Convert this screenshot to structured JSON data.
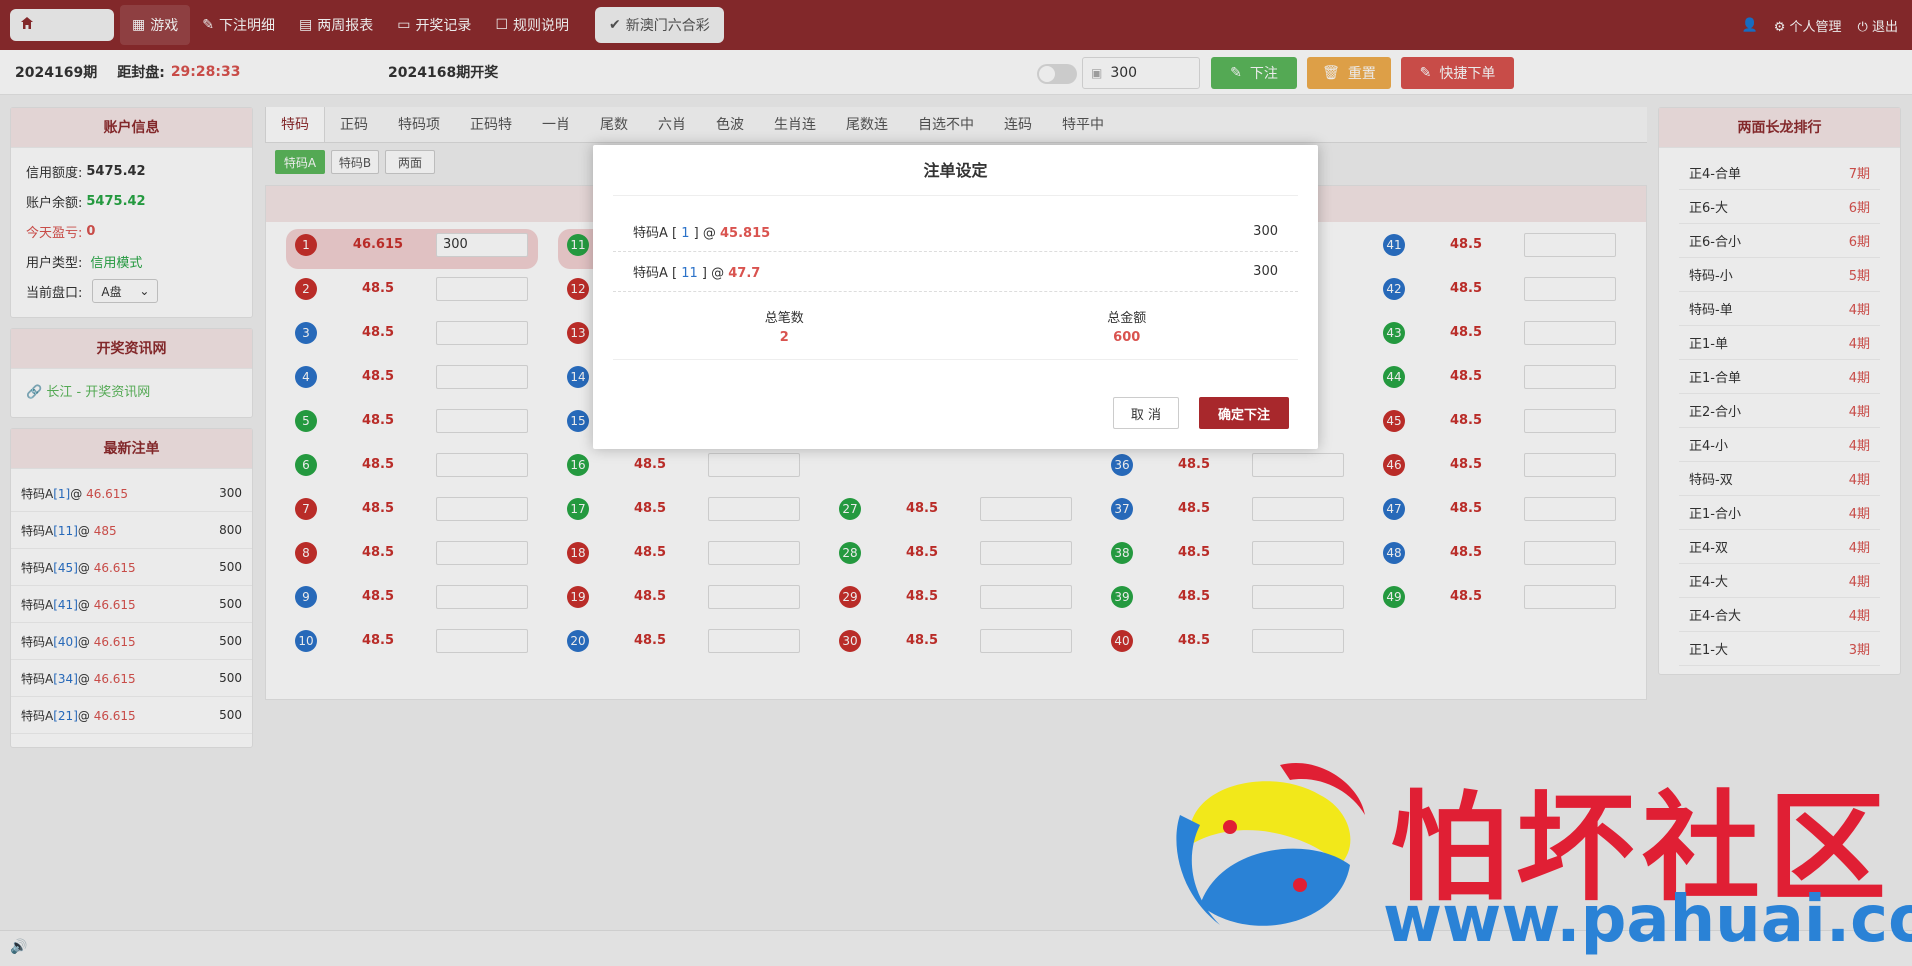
{
  "topbar": {
    "home_icon": "home-icon",
    "nav": [
      {
        "label": "游戏",
        "icon": "grid-icon"
      },
      {
        "label": "下注明细",
        "icon": "pen-icon"
      },
      {
        "label": "两周报表",
        "icon": "calendar-icon"
      },
      {
        "label": "开奖记录",
        "icon": "monitor-icon"
      },
      {
        "label": "规则说明",
        "icon": "doc-icon"
      }
    ],
    "game": "新澳门六合彩",
    "user_manage": "个人管理",
    "logout": "退出"
  },
  "subbar": {
    "period": "2024169期",
    "close_label": "距封盘:",
    "close_time": "29:28:33",
    "last_draw": "2024168期开奖",
    "amount": "300",
    "bet_btn": "下注",
    "reset_btn": "重置",
    "quick_btn": "快捷下单",
    "colors": {
      "green": "#5cb85c",
      "orange": "#f0ad4e",
      "red": "#d9534f"
    }
  },
  "account": {
    "title": "账户信息",
    "credit_label": "信用额度:",
    "credit": "5475.42",
    "balance_label": "账户余额:",
    "balance": "5475.42",
    "pnl_label": "今天盈亏:",
    "pnl": "0",
    "type_label": "用户类型:",
    "type": "信用模式",
    "market_label": "当前盘口:",
    "market": "A盘"
  },
  "info": {
    "title": "开奖资讯网",
    "link": "长江 - 开奖资讯网"
  },
  "recent": {
    "title": "最新注单",
    "items": [
      {
        "name": "特码A",
        "num": "1",
        "odds": "46.615",
        "amount": "300"
      },
      {
        "name": "特码A",
        "num": "11",
        "odds": "485",
        "amount": "800"
      },
      {
        "name": "特码A",
        "num": "45",
        "odds": "46.615",
        "amount": "500"
      },
      {
        "name": "特码A",
        "num": "41",
        "odds": "46.615",
        "amount": "500"
      },
      {
        "name": "特码A",
        "num": "40",
        "odds": "46.615",
        "amount": "500"
      },
      {
        "name": "特码A",
        "num": "34",
        "odds": "46.615",
        "amount": "500"
      },
      {
        "name": "特码A",
        "num": "21",
        "odds": "46.615",
        "amount": "500"
      }
    ]
  },
  "tabs": [
    "特码",
    "正码",
    "特码项",
    "正码特",
    "一肖",
    "尾数",
    "六肖",
    "色波",
    "生肖连",
    "尾数连",
    "自选不中",
    "连码",
    "特平中"
  ],
  "subtabs": [
    "特码A",
    "特码B",
    "两面"
  ],
  "balls": {
    "c1": [
      {
        "n": "1",
        "c": "r",
        "odds": "46.615",
        "val": "300"
      },
      {
        "n": "2",
        "c": "r",
        "odds": "48.5",
        "val": ""
      },
      {
        "n": "3",
        "c": "b",
        "odds": "48.5",
        "val": ""
      },
      {
        "n": "4",
        "c": "b",
        "odds": "48.5",
        "val": ""
      },
      {
        "n": "5",
        "c": "g",
        "odds": "48.5",
        "val": ""
      },
      {
        "n": "6",
        "c": "g",
        "odds": "48.5",
        "val": ""
      },
      {
        "n": "7",
        "c": "r",
        "odds": "48.5",
        "val": ""
      },
      {
        "n": "8",
        "c": "r",
        "odds": "48.5",
        "val": ""
      },
      {
        "n": "9",
        "c": "b",
        "odds": "48.5",
        "val": ""
      },
      {
        "n": "10",
        "c": "b",
        "odds": "48.5",
        "val": ""
      }
    ],
    "c2": [
      {
        "n": "11",
        "c": "g",
        "odds": "",
        "val": ""
      },
      {
        "n": "12",
        "c": "r",
        "odds": "",
        "val": ""
      },
      {
        "n": "13",
        "c": "r",
        "odds": "",
        "val": ""
      },
      {
        "n": "14",
        "c": "b",
        "odds": "",
        "val": ""
      },
      {
        "n": "15",
        "c": "b",
        "odds": "",
        "val": ""
      },
      {
        "n": "16",
        "c": "g",
        "odds": "48.5",
        "val": ""
      },
      {
        "n": "17",
        "c": "g",
        "odds": "48.5",
        "val": ""
      },
      {
        "n": "18",
        "c": "r",
        "odds": "48.5",
        "val": ""
      },
      {
        "n": "19",
        "c": "r",
        "odds": "48.5",
        "val": ""
      },
      {
        "n": "20",
        "c": "b",
        "odds": "48.5",
        "val": ""
      }
    ],
    "c3": [
      {
        "n": "27",
        "c": "g",
        "odds": "48.5",
        "val": ""
      },
      {
        "n": "28",
        "c": "g",
        "odds": "48.5",
        "val": ""
      },
      {
        "n": "29",
        "c": "r",
        "odds": "48.5",
        "val": ""
      },
      {
        "n": "30",
        "c": "r",
        "odds": "48.5",
        "val": ""
      }
    ],
    "c4": [
      {
        "n": "36",
        "c": "b",
        "odds": "48.5",
        "val": ""
      },
      {
        "n": "37",
        "c": "b",
        "odds": "48.5",
        "val": ""
      },
      {
        "n": "38",
        "c": "g",
        "odds": "48.5",
        "val": ""
      },
      {
        "n": "39",
        "c": "g",
        "odds": "48.5",
        "val": ""
      },
      {
        "n": "40",
        "c": "r",
        "odds": "48.5",
        "val": ""
      }
    ],
    "c5": [
      {
        "n": "41",
        "c": "b",
        "odds": "48.5",
        "val": ""
      },
      {
        "n": "42",
        "c": "b",
        "odds": "48.5",
        "val": ""
      },
      {
        "n": "43",
        "c": "g",
        "odds": "48.5",
        "val": ""
      },
      {
        "n": "44",
        "c": "g",
        "odds": "48.5",
        "val": ""
      },
      {
        "n": "45",
        "c": "r",
        "odds": "48.5",
        "val": ""
      },
      {
        "n": "46",
        "c": "r",
        "odds": "48.5",
        "val": ""
      },
      {
        "n": "47",
        "c": "b",
        "odds": "48.5",
        "val": ""
      },
      {
        "n": "48",
        "c": "b",
        "odds": "48.5",
        "val": ""
      },
      {
        "n": "49",
        "c": "g",
        "odds": "48.5",
        "val": ""
      }
    ]
  },
  "modal": {
    "title": "注单设定",
    "rows": [
      {
        "name": "特码A",
        "num": "1",
        "odds": "45.815",
        "amount": "300"
      },
      {
        "name": "特码A",
        "num": "11",
        "odds": "47.7",
        "amount": "300"
      }
    ],
    "count_label": "总笔数",
    "count": "2",
    "total_label": "总金额",
    "total": "600",
    "cancel": "取 消",
    "confirm": "确定下注"
  },
  "rank": {
    "title": "两面长龙排行",
    "items": [
      {
        "name": "正4-合单",
        "period": "7期"
      },
      {
        "name": "正6-大",
        "period": "6期"
      },
      {
        "name": "正6-合小",
        "period": "6期"
      },
      {
        "name": "特码-小",
        "period": "5期"
      },
      {
        "name": "特码-单",
        "period": "4期"
      },
      {
        "name": "正1-单",
        "period": "4期"
      },
      {
        "name": "正1-合单",
        "period": "4期"
      },
      {
        "name": "正2-合小",
        "period": "4期"
      },
      {
        "name": "正4-小",
        "period": "4期"
      },
      {
        "name": "特码-双",
        "period": "4期"
      },
      {
        "name": "正1-合小",
        "period": "4期"
      },
      {
        "name": "正4-双",
        "period": "4期"
      },
      {
        "name": "正4-大",
        "period": "4期"
      },
      {
        "name": "正4-合大",
        "period": "4期"
      },
      {
        "name": "正1-大",
        "period": "3期"
      }
    ]
  },
  "watermark": {
    "text": "怕坏社区",
    "url": "www.pahuai.com"
  }
}
